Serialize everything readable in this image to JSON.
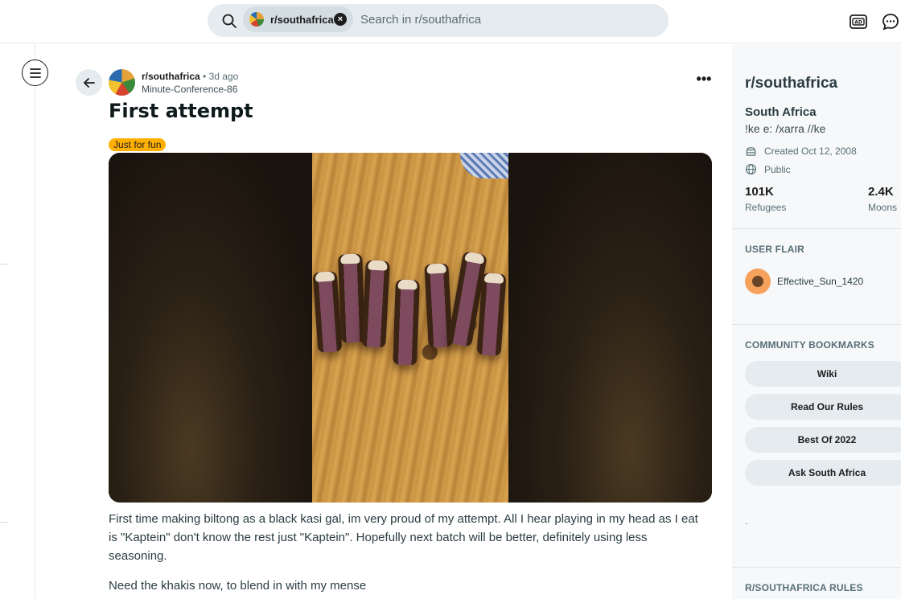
{
  "search": {
    "chip_label": "r/southafrica",
    "chip_close": "×",
    "placeholder": "Search in r/southafrica"
  },
  "post": {
    "subreddit": "r/southafrica",
    "time": "3d ago",
    "separator": "•",
    "author": "Minute-Conference-86",
    "title": "First attempt",
    "flair": "Just for fun",
    "more": "•••",
    "body": [
      "First time making biltong as a black kasi gal, im very proud of my attempt. All I hear playing in my head as I eat is \"Kaptein\" don't know the rest just \"Kaptein\". Hopefully next batch will be better, definitely using less seasoning.",
      "Need the khakis now, to blend in with my mense"
    ]
  },
  "sidebar": {
    "title": "r/southafrica",
    "name": "South Africa",
    "description": "!ke e: /xarra //ke",
    "created": "Created Oct 12, 2008",
    "visibility": "Public",
    "members_value": "101K",
    "members_label": "Refugees",
    "online_value": "2.4K",
    "online_label": "Moons",
    "user_flair_heading": "USER FLAIR",
    "flair_user": "Effective_Sun_1420",
    "bookmarks_heading": "COMMUNITY BOOKMARKS",
    "bookmarks": [
      "Wiki",
      "Read Our Rules",
      "Best Of 2022",
      "Ask South Africa"
    ],
    "dot": ".",
    "rules_heading": "R/SOUTHAFRICA RULES"
  },
  "colors": {
    "flair_bg": "#ffb000",
    "sidebar_bg": "#f6f8f9",
    "search_bg": "#e5ebee"
  }
}
